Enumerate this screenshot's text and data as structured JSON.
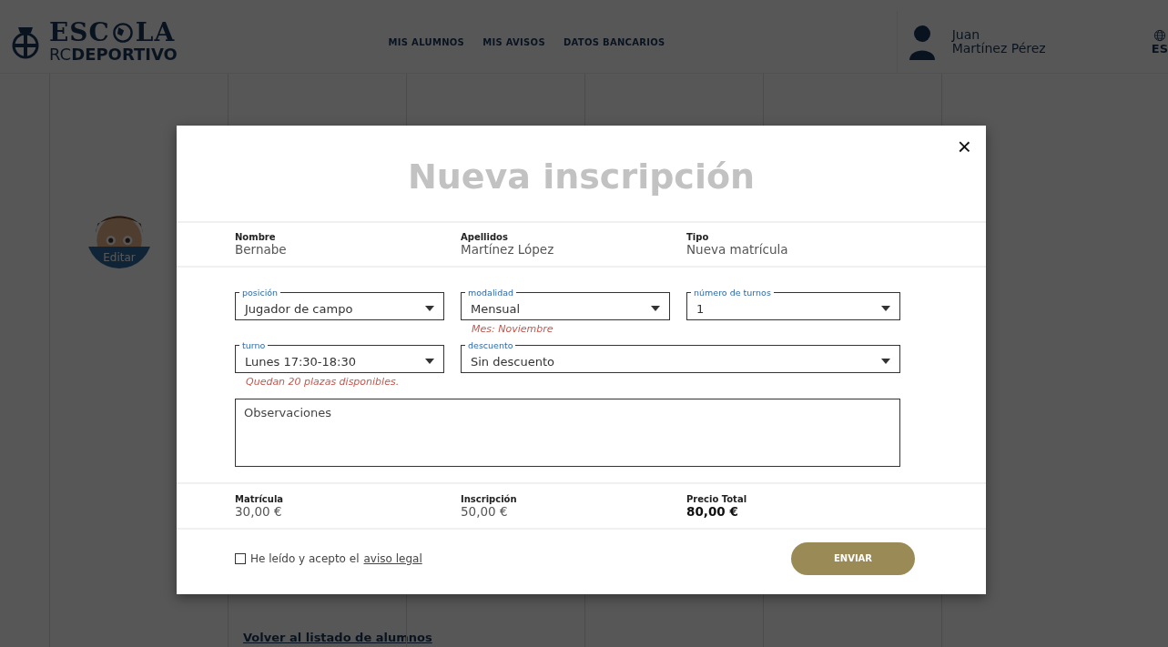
{
  "header": {
    "logo": {
      "word_start": "ESC",
      "word_end": "LA",
      "sub_light": "RC",
      "sub_bold": "DEPORTIVO"
    },
    "nav": [
      "MIS ALUMNOS",
      "MIS AVISOS",
      "DATOS BANCARIOS"
    ],
    "user": {
      "first_name": "Juan",
      "last_name": "Martínez Pérez"
    },
    "language": "ES"
  },
  "background": {
    "avatar_button": "Editar",
    "back_link": "Volver al listado de alumnos"
  },
  "modal": {
    "title": "Nueva inscripción",
    "close": "×",
    "info": [
      {
        "label": "Nombre",
        "value": "Bernabe"
      },
      {
        "label": "Apellidos",
        "value": "Martínez López"
      },
      {
        "label": "Tipo",
        "value": "Nueva matrícula"
      }
    ],
    "fields": [
      {
        "label": "posición",
        "value": "Jugador de campo",
        "wide": false
      },
      {
        "label": "modalidad",
        "value": "Mensual",
        "note": "Mes: Noviembre",
        "wide": false
      },
      {
        "label": "número de turnos",
        "value": "1",
        "wide": false
      },
      {
        "label": "turno",
        "value": "Lunes 17:30-18:30",
        "note": "Quedan 20 plazas disponibles.",
        "wide": false
      },
      {
        "label": "descuento",
        "value": "Sin descuento",
        "wide": true
      }
    ],
    "observations": {
      "placeholder": "Observaciones"
    },
    "totals": [
      {
        "label": "Matrícula",
        "value": "30,00 €",
        "kind": "line"
      },
      {
        "label": "Inscripción",
        "value": "50,00 €",
        "kind": "line"
      },
      {
        "label": "Precio Total",
        "value": "80,00 €",
        "kind": "total"
      }
    ],
    "terms": {
      "checked": false,
      "text": "He leído y acepto el",
      "link": "aviso legal"
    },
    "submit": "ENVIAR"
  }
}
